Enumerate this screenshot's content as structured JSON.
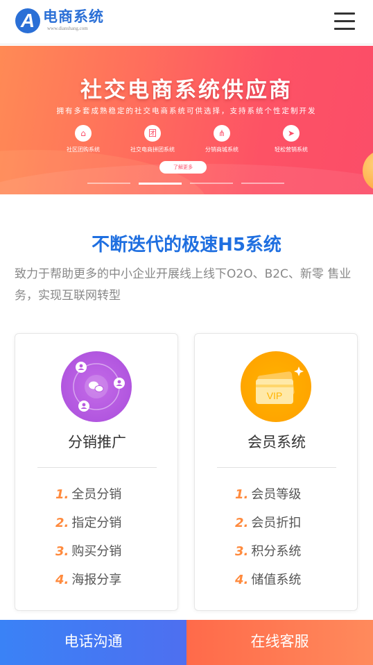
{
  "header": {
    "logo_letter": "A",
    "logo_title": "电商系统",
    "logo_sub": "www.dianshang.com"
  },
  "banner": {
    "title": "社交电商系统供应商",
    "subtitle": "拥有多套成熟稳定的社交电商系统可供选择，支持系统个性定制开发",
    "features": [
      {
        "icon": "home-icon",
        "label": "社区团购系统"
      },
      {
        "icon": "group-icon",
        "label": "社交电商拼团系统"
      },
      {
        "icon": "network-icon",
        "label": "分销商城系统"
      },
      {
        "icon": "send-icon",
        "label": "轻松营销系统"
      }
    ],
    "feature_glyphs": [
      "⌂",
      "团",
      "⋔",
      "➤"
    ],
    "button_label": "了解更多",
    "active_slide": 2,
    "slide_count": 4
  },
  "section": {
    "title": "不断迭代的极速H5系统",
    "description": "致力于帮助更多的中小企业开展线上线下O2O、B2C、新零 售业务，实现互联网转型"
  },
  "cards": [
    {
      "name": "分销推广",
      "icon": "distribution-icon",
      "items": [
        {
          "num": "1.",
          "label": "全员分销"
        },
        {
          "num": "2.",
          "label": "指定分销"
        },
        {
          "num": "3.",
          "label": "购买分销"
        },
        {
          "num": "4.",
          "label": "海报分享"
        }
      ]
    },
    {
      "name": "会员系统",
      "icon": "vip-card-icon",
      "vip_text": "VIP",
      "items": [
        {
          "num": "1.",
          "label": "会员等级"
        },
        {
          "num": "2.",
          "label": "会员折扣"
        },
        {
          "num": "3.",
          "label": "积分系统"
        },
        {
          "num": "4.",
          "label": "储值系统"
        }
      ]
    }
  ],
  "bottom_bar": {
    "phone_label": "电话沟通",
    "service_label": "在线客服"
  },
  "colors": {
    "brand_blue": "#2a6fd6",
    "title_blue": "#1f6fe0",
    "banner_red": "#fb4d68",
    "accent_orange": "#ff8a3d"
  }
}
